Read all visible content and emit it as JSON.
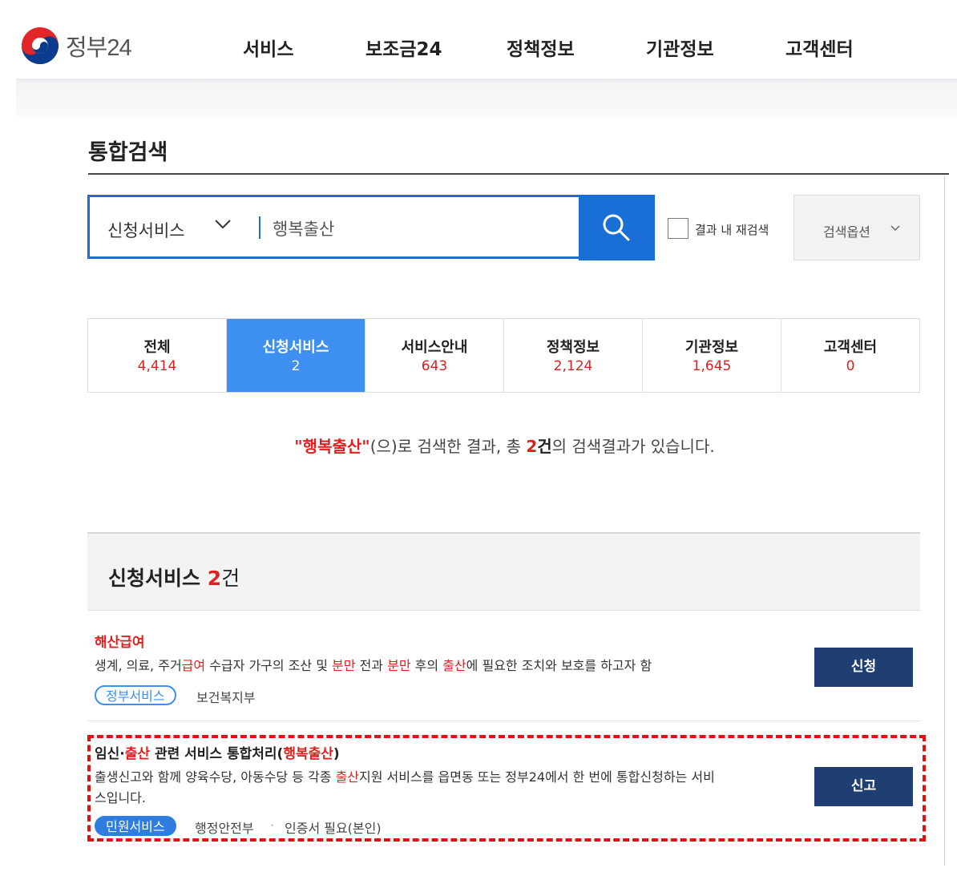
{
  "header": {
    "logo_text": "정부24",
    "nav": [
      "서비스",
      "보조금24",
      "정책정보",
      "기관정보",
      "고객센터"
    ]
  },
  "page_title": "통합검색",
  "search": {
    "category": "신청서비스",
    "query": "행복출산",
    "recheck_label": "결과 내 재검색",
    "options_label": "검색옵션"
  },
  "tabs": [
    {
      "label": "전체",
      "count": "4,414"
    },
    {
      "label": "신청서비스",
      "count": "2",
      "active": true
    },
    {
      "label": "서비스안내",
      "count": "643"
    },
    {
      "label": "정책정보",
      "count": "2,124"
    },
    {
      "label": "기관정보",
      "count": "1,645"
    },
    {
      "label": "고객센터",
      "count": "0"
    }
  ],
  "summary": {
    "query_quoted": "\"행복출산\"",
    "text1": "(으)로 검색한 결과, 총 ",
    "count": "2건",
    "text2": "의 검색결과가 있습니다."
  },
  "section": {
    "title": "신청서비스",
    "count": "2",
    "unit": "건"
  },
  "results": [
    {
      "title": "해산급여",
      "desc_parts": [
        "생계, 의료, 주거",
        "급여",
        " 수급자 가구의 조산 및 ",
        "분만",
        " 전과 ",
        "분만",
        " 후의 ",
        "출산",
        "에 필요한 조치와 보호를 하고자 함"
      ],
      "badge": "정부서비스",
      "agency": "보건복지부",
      "button": "신청"
    },
    {
      "title_parts": [
        "임신·",
        "출산",
        " 관련 서비스 통합처리(",
        "행복출산",
        ")"
      ],
      "desc_line1_parts": [
        "출생신고와 함께 양육수당, 아동수당 등 각종 ",
        "출산",
        "지원 서비스를 읍면동 또는 정부24에서 한 번에 통합신청하는 서비"
      ],
      "desc_line2": "스입니다.",
      "badge": "민원서비스",
      "agency": "행정안전부",
      "sep": "·",
      "cert": "인증서 필요(본인)",
      "button": "신고"
    }
  ],
  "colors": {
    "primary_blue": "#1a6fd6",
    "tab_active": "#3d8ff0",
    "highlight_red": "#e02020",
    "button_navy": "#1f3f73",
    "annotation_red": "#e21111"
  }
}
